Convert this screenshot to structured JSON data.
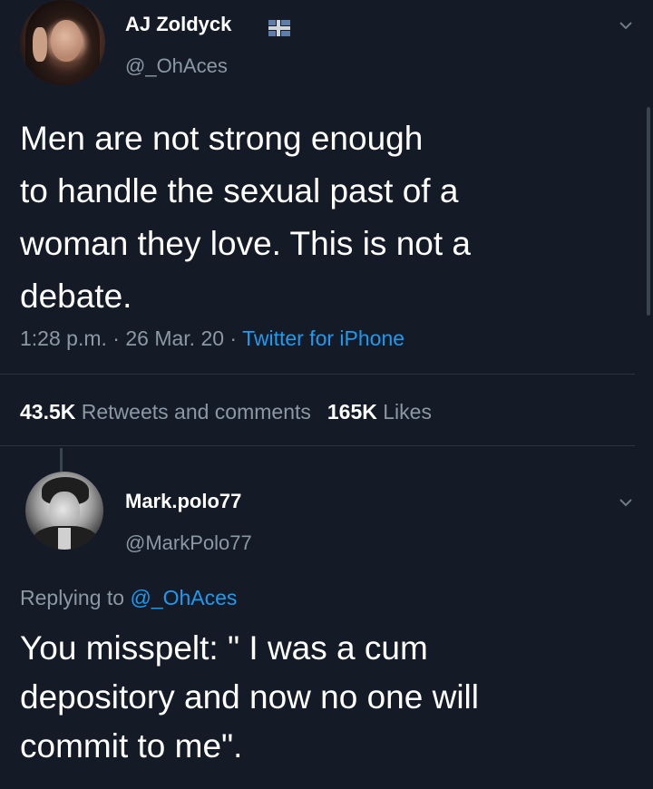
{
  "tweet": {
    "author_name": "AJ Zoldyck",
    "author_handle": "@_OhAces",
    "text": "Men are not strong enough\nto handle the sexual past of a\nwoman they love. This is not a\ndebate.",
    "time": "1:28 p.m.",
    "separator": " · ",
    "date": "26 Mar. 20",
    "source": "Twitter for iPhone",
    "retweets_count": "43.5K",
    "retweets_label": "Retweets and comments",
    "likes_count": "165K",
    "likes_label": "Likes",
    "flag_icon": "flag-icon",
    "menu_icon": "chevron-down-icon"
  },
  "reply": {
    "author_name": "Mark.polo77",
    "author_handle": "@MarkPolo77",
    "replying_label": "Replying to",
    "replying_handle": "@_OhAces",
    "text": "You misspelt: \" I was a cum\ndepository and now no one will\ncommit to me\".",
    "menu_icon": "chevron-down-icon"
  },
  "colors": {
    "background": "#141a26",
    "text": "#ffffff",
    "secondary": "#8b98a5",
    "link": "#1d9bf0"
  }
}
